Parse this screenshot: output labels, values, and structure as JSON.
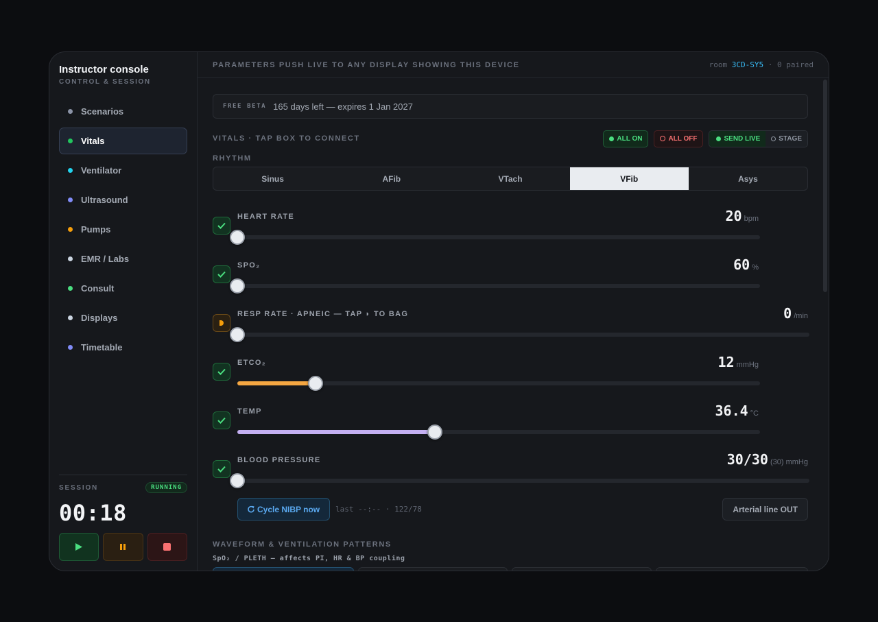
{
  "sidebar": {
    "title": "Instructor console",
    "subtitle": "CONTROL & SESSION",
    "items": [
      {
        "label": "Scenarios",
        "color": "#8b93a7"
      },
      {
        "label": "Vitals",
        "color": "#22c55e",
        "active": true
      },
      {
        "label": "Ventilator",
        "color": "#22d3ee"
      },
      {
        "label": "Ultrasound",
        "color": "#818cf8"
      },
      {
        "label": "Pumps",
        "color": "#f59e0b"
      },
      {
        "label": "EMR / Labs",
        "color": "#cbd5e1"
      },
      {
        "label": "Consult",
        "color": "#4ade80"
      },
      {
        "label": "Displays",
        "color": "#cbd5e1"
      },
      {
        "label": "Timetable",
        "color": "#818cf8"
      }
    ]
  },
  "session": {
    "label": "SESSION",
    "status": "RUNNING",
    "timer": "00:18",
    "controls": [
      {
        "icon": "play-icon"
      },
      {
        "icon": "pause-icon"
      },
      {
        "icon": "stop-icon"
      }
    ]
  },
  "topbar": {
    "message": "PARAMETERS PUSH LIVE TO ANY DISPLAY SHOWING THIS DEVICE",
    "room_prefix": "room",
    "room_code": "3CD-SY5",
    "paired": "· 0 paired"
  },
  "beta": {
    "tag": "FREE BETA",
    "text": "165 days left — expires 1 Jan 2027"
  },
  "vitals_header": {
    "label": "VITALS · TAP BOX TO CONNECT",
    "all_on": "ALL ON",
    "all_off": "ALL OFF",
    "send_live": "SEND LIVE",
    "stage": "STAGE"
  },
  "rhythm": {
    "label": "RHYTHM",
    "options": [
      "Sinus",
      "AFib",
      "VTach",
      "VFib",
      "Asys"
    ],
    "selected": "VFib"
  },
  "vitals": [
    {
      "name": "HEART RATE",
      "value": "20",
      "unit": "bpm",
      "level": 0.0,
      "checked": true,
      "color": ""
    },
    {
      "name": "SPO₂",
      "value": "60",
      "unit": "%",
      "level": 0.0,
      "checked": true,
      "color": ""
    },
    {
      "name": "RESP RATE · APNEIC — TAP ◗ TO BAG",
      "value": "0",
      "unit": "/min",
      "level": 0.0,
      "checked": false,
      "color": ""
    },
    {
      "name": "ETCO₂",
      "value": "12",
      "unit": "mmHg",
      "level": 0.15,
      "checked": true,
      "color": "#f5a742"
    },
    {
      "name": "TEMP",
      "value": "36.4",
      "unit": "°C",
      "level": 0.378,
      "checked": true,
      "color": "#c4b0f2"
    },
    {
      "name": "BLOOD PRESSURE",
      "value": "30/30",
      "unit": "(30) mmHg",
      "level": 0.0,
      "checked": true,
      "color": ""
    }
  ],
  "nibp": {
    "button": "Cycle NIBP now",
    "last": "last --:-- · 122/78",
    "arterial": "Arterial line OUT"
  },
  "waveform": {
    "label": "WAVEFORM & VENTILATION PATTERNS",
    "sub": "SpO₂ / PLETH — affects PI, HR & BP coupling"
  }
}
